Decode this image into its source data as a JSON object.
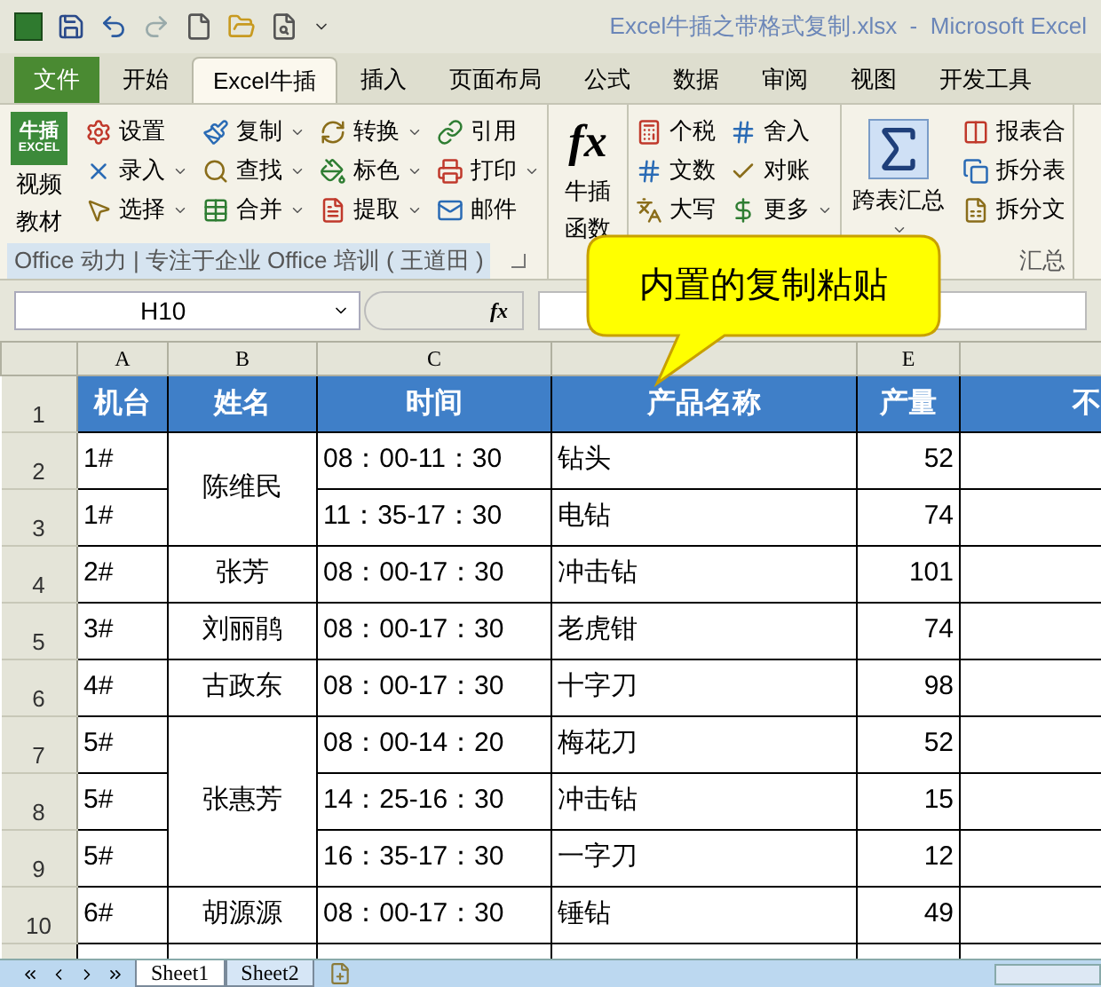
{
  "window": {
    "title": "Excel牛插之带格式复制.xlsx  -  Microsoft Excel"
  },
  "tabs": [
    {
      "label": "文件",
      "kind": "file",
      "selected": false
    },
    {
      "label": "开始",
      "kind": "tab",
      "selected": false
    },
    {
      "label": "Excel牛插",
      "kind": "tab",
      "selected": true
    },
    {
      "label": "插入",
      "kind": "tab",
      "selected": false
    },
    {
      "label": "页面布局",
      "kind": "tab",
      "selected": false
    },
    {
      "label": "公式",
      "kind": "tab",
      "selected": false
    },
    {
      "label": "数据",
      "kind": "tab",
      "selected": false
    },
    {
      "label": "审阅",
      "kind": "tab",
      "selected": false
    },
    {
      "label": "视图",
      "kind": "tab",
      "selected": false
    },
    {
      "label": "开发工具",
      "kind": "tab",
      "selected": false
    }
  ],
  "ribbon": {
    "groups": [
      {
        "label": "Office 动力 | 专注于企业 Office 培训 ( 王道田 )",
        "logo": {
          "line1": "牛插",
          "line2": "EXCEL"
        },
        "big_label": [
          "视频",
          "教材"
        ],
        "columns": [
          [
            {
              "label": "设置",
              "dropdown": false
            },
            {
              "label": "录入",
              "dropdown": true
            },
            {
              "label": "选择",
              "dropdown": true
            }
          ],
          [
            {
              "label": "复制",
              "dropdown": true
            },
            {
              "label": "查找",
              "dropdown": true
            },
            {
              "label": "合并",
              "dropdown": true
            }
          ],
          [
            {
              "label": "转换",
              "dropdown": true
            },
            {
              "label": "标色",
              "dropdown": true
            },
            {
              "label": "提取",
              "dropdown": true
            }
          ],
          [
            {
              "label": "引用",
              "dropdown": false
            },
            {
              "label": "打印",
              "dropdown": true
            },
            {
              "label": "邮件",
              "dropdown": false
            }
          ]
        ]
      },
      {
        "icon_text": "fx",
        "big_label": [
          "牛插",
          "函数"
        ]
      },
      {
        "columns": [
          [
            {
              "label": "个税",
              "dropdown": false
            },
            {
              "label": "文数",
              "dropdown": false
            },
            {
              "label": "大写",
              "dropdown": false
            }
          ],
          [
            {
              "label": "舍入",
              "dropdown": false
            },
            {
              "label": "对账",
              "dropdown": false
            },
            {
              "label": "更多",
              "dropdown": true
            }
          ]
        ]
      },
      {
        "label": "汇总",
        "big_label": [
          "跨表汇总"
        ],
        "columns": [
          [
            {
              "label": "报表合",
              "dropdown": false
            },
            {
              "label": "拆分表",
              "dropdown": false
            },
            {
              "label": "拆分文",
              "dropdown": false
            }
          ]
        ]
      }
    ]
  },
  "formula_bar": {
    "name_box": "H10",
    "function_button": "fx"
  },
  "callout": "内置的复制粘贴",
  "sheet": {
    "columns": [
      {
        "letter": "A"
      },
      {
        "letter": "B"
      },
      {
        "letter": "C"
      },
      {},
      {
        "letter": "E"
      },
      {}
    ],
    "header_row": {
      "number": "1",
      "cells": [
        "机台",
        "姓名",
        "时间",
        "产品名称",
        "产量",
        "不"
      ]
    },
    "groups": [
      {
        "name": "陈维民",
        "rows": [
          {
            "number": "2",
            "machine": "1#",
            "time": "08：00-11：30",
            "product": "钻头",
            "output": "52"
          },
          {
            "number": "3",
            "machine": "1#",
            "time": "11：35-17：30",
            "product": "电钻",
            "output": "74"
          }
        ]
      },
      {
        "name": "张芳",
        "rows": [
          {
            "number": "4",
            "machine": "2#",
            "time": "08：00-17：30",
            "product": "冲击钻",
            "output": "101"
          }
        ]
      },
      {
        "name": "刘丽鹃",
        "rows": [
          {
            "number": "5",
            "machine": "3#",
            "time": "08：00-17：30",
            "product": "老虎钳",
            "output": "74"
          }
        ]
      },
      {
        "name": "古政东",
        "rows": [
          {
            "number": "6",
            "machine": "4#",
            "time": "08：00-17：30",
            "product": "十字刀",
            "output": "98"
          }
        ]
      },
      {
        "name": "张惠芳",
        "rows": [
          {
            "number": "7",
            "machine": "5#",
            "time": "08：00-14：20",
            "product": "梅花刀",
            "output": "52"
          },
          {
            "number": "8",
            "machine": "5#",
            "time": "14：25-16：30",
            "product": "冲击钻",
            "output": "15"
          },
          {
            "number": "9",
            "machine": "5#",
            "time": "16：35-17：30",
            "product": "一字刀",
            "output": "12"
          }
        ]
      },
      {
        "name": "胡源源",
        "rows": [
          {
            "number": "10",
            "machine": "6#",
            "time": "08：00-17：30",
            "product": "锤钻",
            "output": "49"
          }
        ]
      }
    ]
  },
  "sheet_tabs": [
    {
      "label": "Sheet1",
      "selected": true
    },
    {
      "label": "Sheet2",
      "selected": false
    }
  ]
}
